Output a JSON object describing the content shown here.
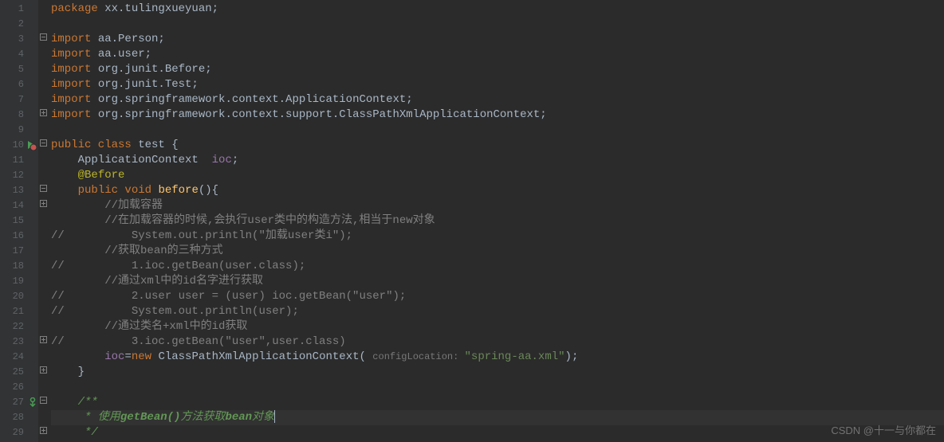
{
  "lines": [
    {
      "num": "1",
      "tokens": [
        {
          "t": "package ",
          "c": "kw"
        },
        {
          "t": "xx.tulingxueyuan;",
          "c": "pkg"
        }
      ]
    },
    {
      "num": "2",
      "tokens": []
    },
    {
      "num": "3",
      "tokens": [
        {
          "t": "import ",
          "c": "kw"
        },
        {
          "t": "aa.Person;",
          "c": "pkg"
        }
      ],
      "fold": "⊟"
    },
    {
      "num": "4",
      "tokens": [
        {
          "t": "import ",
          "c": "kw"
        },
        {
          "t": "aa.user;",
          "c": "pkg"
        }
      ]
    },
    {
      "num": "5",
      "tokens": [
        {
          "t": "import ",
          "c": "kw"
        },
        {
          "t": "org.junit.Before;",
          "c": "pkg"
        }
      ]
    },
    {
      "num": "6",
      "tokens": [
        {
          "t": "import ",
          "c": "kw"
        },
        {
          "t": "org.junit.Test;",
          "c": "pkg"
        }
      ]
    },
    {
      "num": "7",
      "tokens": [
        {
          "t": "import ",
          "c": "kw"
        },
        {
          "t": "org.springframework.context.ApplicationContext;",
          "c": "pkg"
        }
      ]
    },
    {
      "num": "8",
      "tokens": [
        {
          "t": "import ",
          "c": "kw"
        },
        {
          "t": "org.springframework.context.support.ClassPathXmlApplicationContext;",
          "c": "pkg"
        }
      ],
      "fold": "⊞"
    },
    {
      "num": "9",
      "tokens": []
    },
    {
      "num": "10",
      "tokens": [
        {
          "t": "public class ",
          "c": "kw"
        },
        {
          "t": "test ",
          "c": "cls"
        },
        {
          "t": "{",
          "c": ""
        }
      ],
      "icon": "run",
      "fold": "⊟"
    },
    {
      "num": "11",
      "tokens": [
        {
          "t": "    ApplicationContext  ",
          "c": ""
        },
        {
          "t": "ioc",
          "c": "fld"
        },
        {
          "t": ";",
          "c": ""
        }
      ]
    },
    {
      "num": "12",
      "tokens": [
        {
          "t": "    ",
          "c": ""
        },
        {
          "t": "@Before",
          "c": "anno"
        }
      ]
    },
    {
      "num": "13",
      "tokens": [
        {
          "t": "    ",
          "c": ""
        },
        {
          "t": "public void ",
          "c": "kw"
        },
        {
          "t": "before",
          "c": "method"
        },
        {
          "t": "(){",
          "c": ""
        }
      ],
      "fold": "⊟"
    },
    {
      "num": "14",
      "tokens": [
        {
          "t": "        ",
          "c": ""
        },
        {
          "t": "//加载容器",
          "c": "cmt"
        }
      ],
      "fold": "⊞"
    },
    {
      "num": "15",
      "tokens": [
        {
          "t": "        ",
          "c": ""
        },
        {
          "t": "//在加载容器的时候,会执行user类中的构造方法,相当于new对象",
          "c": "cmt"
        }
      ]
    },
    {
      "num": "16",
      "tokens": [
        {
          "t": "//          System.out.println(\"加载user类i\");",
          "c": "cmt"
        }
      ]
    },
    {
      "num": "17",
      "tokens": [
        {
          "t": "        ",
          "c": ""
        },
        {
          "t": "//获取bean的三种方式",
          "c": "cmt"
        }
      ]
    },
    {
      "num": "18",
      "tokens": [
        {
          "t": "//          1.ioc.getBean(user.class);",
          "c": "cmt"
        }
      ]
    },
    {
      "num": "19",
      "tokens": [
        {
          "t": "        ",
          "c": ""
        },
        {
          "t": "//通过xml中的id名字进行获取",
          "c": "cmt"
        }
      ]
    },
    {
      "num": "20",
      "tokens": [
        {
          "t": "//          2.user user = (user) ioc.getBean(\"user\");",
          "c": "cmt"
        }
      ]
    },
    {
      "num": "21",
      "tokens": [
        {
          "t": "//          System.out.println(user);",
          "c": "cmt"
        }
      ]
    },
    {
      "num": "22",
      "tokens": [
        {
          "t": "        ",
          "c": ""
        },
        {
          "t": "//通过类名+xml中的id获取",
          "c": "cmt"
        }
      ]
    },
    {
      "num": "23",
      "tokens": [
        {
          "t": "//          3.ioc.getBean(\"user\",user.class)",
          "c": "cmt"
        }
      ],
      "fold": "⊞"
    },
    {
      "num": "24",
      "tokens": [
        {
          "t": "        ",
          "c": ""
        },
        {
          "t": "ioc",
          "c": "fld"
        },
        {
          "t": "=",
          "c": ""
        },
        {
          "t": "new ",
          "c": "kw"
        },
        {
          "t": "ClassPathXmlApplicationContext( ",
          "c": ""
        },
        {
          "t": "configLocation: ",
          "c": "param-hint"
        },
        {
          "t": "\"spring-aa.xml\"",
          "c": "str"
        },
        {
          "t": ");",
          "c": ""
        }
      ]
    },
    {
      "num": "25",
      "tokens": [
        {
          "t": "    }",
          "c": ""
        }
      ],
      "fold": "⊞"
    },
    {
      "num": "26",
      "tokens": []
    },
    {
      "num": "27",
      "tokens": [
        {
          "t": "    ",
          "c": ""
        },
        {
          "t": "/**",
          "c": "doc"
        }
      ],
      "fold": "⊟",
      "icon": "impl"
    },
    {
      "num": "28",
      "tokens": [
        {
          "t": "     * 使用",
          "c": "doc"
        },
        {
          "t": "getBean()",
          "c": "doc-kw"
        },
        {
          "t": "方法获取",
          "c": "doc"
        },
        {
          "t": "bean",
          "c": "doc-kw"
        },
        {
          "t": "对象",
          "c": "doc"
        }
      ],
      "highlight": true,
      "caret": true
    },
    {
      "num": "29",
      "tokens": [
        {
          "t": "     */",
          "c": "doc"
        }
      ],
      "fold": "⊞"
    }
  ],
  "watermark": "CSDN @十一与你都在"
}
